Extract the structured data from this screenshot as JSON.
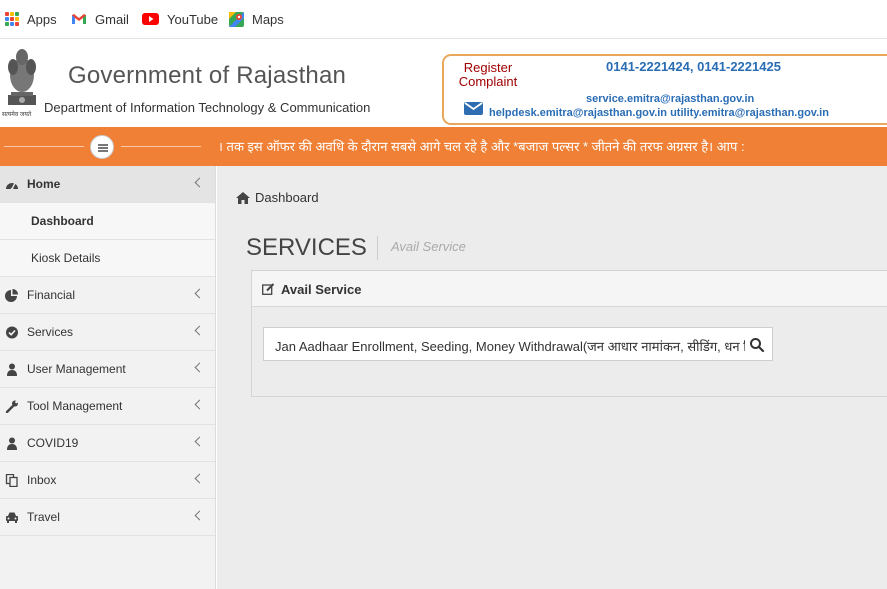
{
  "bookmarks": {
    "items": [
      {
        "label": "Apps",
        "icon": "apps-grid-icon"
      },
      {
        "label": "Gmail",
        "icon": "gmail-icon"
      },
      {
        "label": "YouTube",
        "icon": "youtube-icon"
      },
      {
        "label": "Maps",
        "icon": "maps-icon"
      }
    ]
  },
  "header": {
    "emblem_caption": "सत्यमेव जयते",
    "title": "Government of Rajasthan",
    "department": "Department of Information Technology & Communication",
    "register_complaint": "Register Complaint",
    "phones": "0141-2221424, 0141-2221425",
    "email_primary": "service.emitra@rajasthan.gov.in",
    "email_secondary": "helpdesk.emitra@rajasthan.gov.in utility.emitra@rajasthan.gov.in",
    "accent_color": "#ef8035",
    "link_color": "#2a6db5"
  },
  "marquee": {
    "text": "। तक इस ऑफर की अवधि के दौरान सबसे आगे चल रहे है और *बजाज पल्सर * जीतने की तरफ अग्रसर है। आप :"
  },
  "sidebar": {
    "items": [
      {
        "label": "Home",
        "icon": "dashboard-icon",
        "expanded": true
      },
      {
        "label": "Dashboard",
        "sub": true
      },
      {
        "label": "Kiosk Details",
        "sub": true
      },
      {
        "label": "Financial",
        "icon": "pie-chart-icon"
      },
      {
        "label": "Services",
        "icon": "check-circle-icon"
      },
      {
        "label": "User Management",
        "icon": "user-icon"
      },
      {
        "label": "Tool Management",
        "icon": "wrench-icon"
      },
      {
        "label": "COVID19",
        "icon": "user-icon"
      },
      {
        "label": "Inbox",
        "icon": "copy-icon"
      },
      {
        "label": "Travel",
        "icon": "car-icon"
      }
    ]
  },
  "main": {
    "breadcrumb": "Dashboard",
    "page_title": "SERVICES",
    "page_subtitle": "Avail Service",
    "panel_title": "Avail Service",
    "search_value": "Jan Aadhaar Enrollment, Seeding, Money Withdrawal(जन आधार नामांकन, सीडिंग, धन निकासी)"
  }
}
